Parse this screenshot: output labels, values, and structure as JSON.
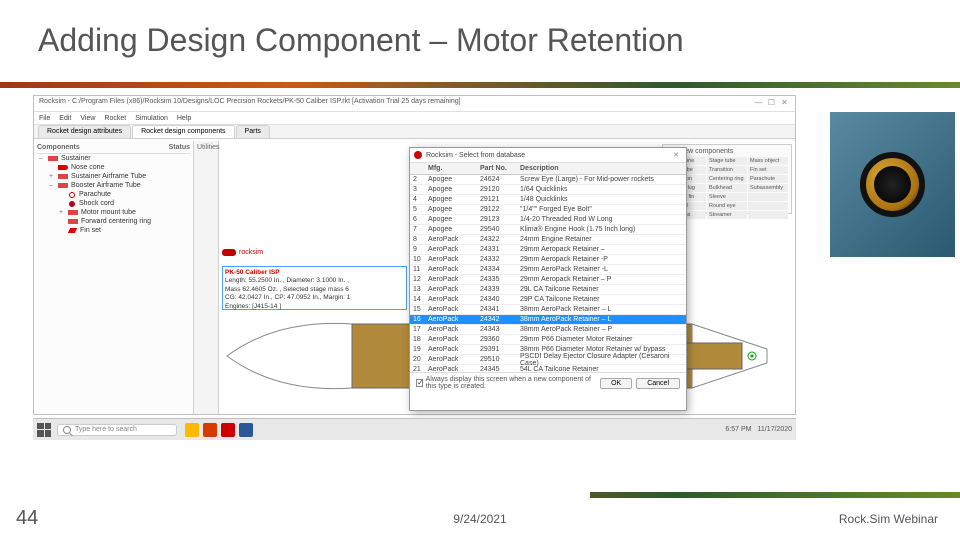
{
  "slide": {
    "title": "Adding Design Component – Motor Retention",
    "page_number": "44",
    "date": "9/24/2021",
    "footer": "Rock.Sim Webinar"
  },
  "window": {
    "title": "Rocksim - C:/Program Files (x86)/Rocksim 10/Designs/LOC Precision Rockets/PK-50 Caliber ISP.rkt  [Activation Trial 25 days remaining]",
    "menus": [
      "File",
      "Edit",
      "View",
      "Rocket",
      "Simulation",
      "Help"
    ],
    "tabs": [
      "Rocket design attributes",
      "Rocket design components",
      "Parts"
    ],
    "tree_header": [
      "Components",
      "Status"
    ],
    "tree": [
      {
        "indent": 0,
        "exp": "–",
        "icon": "sus",
        "label": "Sustainer"
      },
      {
        "indent": 1,
        "exp": "",
        "icon": "nc",
        "label": "Nose cone"
      },
      {
        "indent": 1,
        "exp": "+",
        "icon": "bt",
        "label": "Sustainer Airframe Tube"
      },
      {
        "indent": 1,
        "exp": "–",
        "icon": "bt",
        "label": "Booster Airframe Tube"
      },
      {
        "indent": 2,
        "exp": "",
        "icon": "mass",
        "label": "Parachute"
      },
      {
        "indent": 2,
        "exp": "",
        "icon": "massm",
        "label": "Shock cord"
      },
      {
        "indent": 2,
        "exp": "+",
        "icon": "bt",
        "label": "Motor mount tube"
      },
      {
        "indent": 2,
        "exp": "",
        "icon": "bt",
        "label": "Forward centering ring"
      },
      {
        "indent": 2,
        "exp": "",
        "icon": "fin",
        "label": "Fin set"
      }
    ],
    "mid_label": "Utilities",
    "rightpanel": {
      "title": "Add new components",
      "cells": [
        "Nose cone",
        "Stage tube",
        "Mass object",
        "Body tube",
        "Transition",
        "Fin set",
        "Transition",
        "Centering ring",
        "Parachute",
        "Launch lug",
        "Bulkhead",
        "Subassembly",
        "Custom fin",
        "Sleeve",
        "",
        "Ring tail",
        "Round eye",
        "",
        "Tube fins",
        "Streamer",
        ""
      ]
    },
    "info": {
      "title": "PK-50 Caliber ISP",
      "lines": [
        "Length: 55.2500 In. , Diameter: 3.1000 In. ,",
        "Mass 62.4605 Oz. , Selected stage mass 6",
        "CG: 42.0427 In., CP: 47.0952 In., Margin: 1",
        "Engines: [J415-14 ]"
      ]
    },
    "rview_tab": "rocksim"
  },
  "dialog": {
    "title": "Rocksim - Select from database",
    "headers": [
      "",
      "Mfg.",
      "Part No.",
      "Description"
    ],
    "rows": [
      {
        "n": "2",
        "m": "Apogee",
        "p": "24624",
        "d": "Screw Eye (Large) - For Mid-power rockets"
      },
      {
        "n": "3",
        "m": "Apogee",
        "p": "29120",
        "d": "1/64 Quicklinks"
      },
      {
        "n": "4",
        "m": "Apogee",
        "p": "29121",
        "d": "1/48 Quicklinks"
      },
      {
        "n": "5",
        "m": "Apogee",
        "p": "29122",
        "d": "\"1/4\"\" Forged Eye Bolt\""
      },
      {
        "n": "6",
        "m": "Apogee",
        "p": "29123",
        "d": "1/4-20 Threaded Rod W Long"
      },
      {
        "n": "7",
        "m": "Apogee",
        "p": "29540",
        "d": "Klima® Engine Hook (1.75 Inch long)"
      },
      {
        "n": "8",
        "m": "AeroPack",
        "p": "24322",
        "d": "24mm Engine Retainer"
      },
      {
        "n": "9",
        "m": "AeroPack",
        "p": "24331",
        "d": "29mm Aeropack Retainer –"
      },
      {
        "n": "10",
        "m": "AeroPack",
        "p": "24332",
        "d": "29mm Aeropack Retainer -P"
      },
      {
        "n": "11",
        "m": "AeroPack",
        "p": "24334",
        "d": "29mm AeroPack Retainer -L"
      },
      {
        "n": "12",
        "m": "AeroPack",
        "p": "24335",
        "d": "29mm Aeropack Retainer – P"
      },
      {
        "n": "13",
        "m": "AeroPack",
        "p": "24339",
        "d": "29L CA Tailcone Retainer"
      },
      {
        "n": "14",
        "m": "AeroPack",
        "p": "24340",
        "d": "29P CA Tailcone Retainer"
      },
      {
        "n": "15",
        "m": "AeroPack",
        "p": "24341",
        "d": "38mm AeroPack Retainer – L"
      },
      {
        "n": "16",
        "m": "AeroPack",
        "p": "24342",
        "d": "38mm AeroPack Retainer – L"
      },
      {
        "n": "17",
        "m": "AeroPack",
        "p": "24343",
        "d": "38mm AeroPack Retainer – P"
      },
      {
        "n": "18",
        "m": "AeroPack",
        "p": "29360",
        "d": "29mm P66 Diameter Motor Retainer"
      },
      {
        "n": "19",
        "m": "AeroPack",
        "p": "29391",
        "d": "38mm P66 Diameter Motor Retainer w/ bypass"
      },
      {
        "n": "20",
        "m": "AeroPack",
        "p": "29510",
        "d": "PSCDI Delay Ejector Closure Adapter (Cesaroni Case)"
      },
      {
        "n": "21",
        "m": "AeroPack",
        "p": "24345",
        "d": "54L CA Tailcone Retainer"
      }
    ],
    "selected_index": 14,
    "checkbox": "Always display this screen when a new component of this type is created.",
    "ok": "OK",
    "cancel": "Cancel"
  },
  "taskbar": {
    "search_placeholder": "Type here to search",
    "time": "6:57 PM",
    "date": "11/17/2020"
  }
}
